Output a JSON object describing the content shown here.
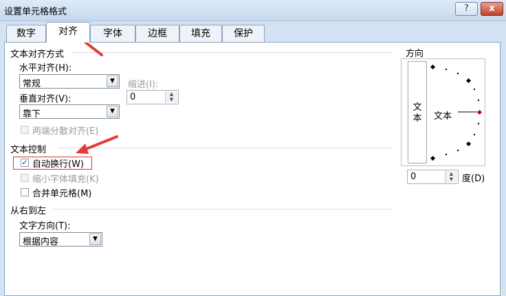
{
  "window": {
    "title": "设置单元格格式",
    "help_label": "?",
    "close_label": "x"
  },
  "tabs": [
    {
      "label": "数字"
    },
    {
      "label": "对齐"
    },
    {
      "label": "字体"
    },
    {
      "label": "边框"
    },
    {
      "label": "填充"
    },
    {
      "label": "保护"
    }
  ],
  "active_tab": "对齐",
  "alignment": {
    "section_title": "文本对齐方式",
    "horizontal_label": "水平对齐(H):",
    "horizontal_value": "常规",
    "vertical_label": "垂直对齐(V):",
    "vertical_value": "靠下",
    "indent_label": "缩进(I):",
    "indent_value": "0",
    "distributed_label": "两端分散对齐(E)"
  },
  "text_control": {
    "section_title": "文本控制",
    "wrap_label": "自动换行(W)",
    "wrap_checked": true,
    "shrink_label": "缩小字体填充(K)",
    "merge_label": "合并单元格(M)"
  },
  "rtl": {
    "section_title": "从右到左",
    "direction_label": "文字方向(T):",
    "direction_value": "根据内容"
  },
  "orientation": {
    "section_title": "方向",
    "vertical_text": "文本",
    "dial_text": "文本",
    "degrees_value": "0",
    "degrees_label": "度(D)"
  }
}
